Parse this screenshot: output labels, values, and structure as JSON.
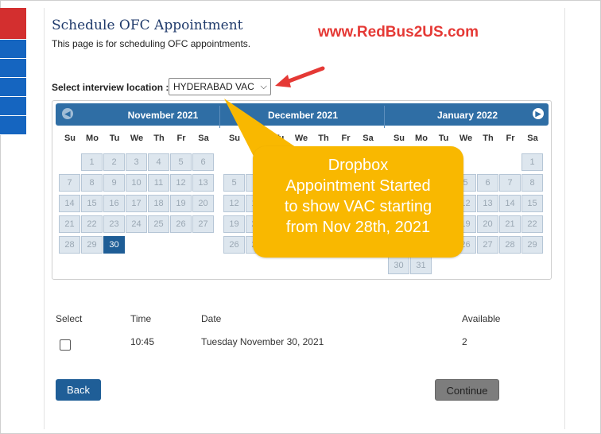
{
  "page": {
    "title": "Schedule OFC Appointment",
    "subtitle": "This page is for scheduling OFC appointments."
  },
  "watermark": "www.RedBus2US.com",
  "location": {
    "label": "Select interview location :",
    "value": "HYDERABAD VAC"
  },
  "calendar": {
    "weekdays": [
      "Su",
      "Mo",
      "Tu",
      "We",
      "Th",
      "Fr",
      "Sa"
    ],
    "months": [
      {
        "name": "November 2021"
      },
      {
        "name": "December 2021"
      },
      {
        "name": "January 2022"
      }
    ],
    "selected_date": "November 30, 2021",
    "nav_prev_icon": "chevron-left-icon",
    "nav_next_icon": "chevron-right-icon"
  },
  "callout": {
    "lines": [
      "Dropbox",
      "Appointment Started",
      "to show VAC starting",
      "from Nov 28th, 2021"
    ],
    "color": "#f9b800"
  },
  "table": {
    "headers": {
      "select": "Select",
      "time": "Time",
      "date": "Date",
      "available": "Available"
    },
    "rows": [
      {
        "time": "10:45",
        "date": "Tuesday November 30, 2021",
        "available": "2"
      }
    ]
  },
  "buttons": {
    "back": "Back",
    "continue": "Continue"
  },
  "colors": {
    "header": "#2f6ea5",
    "selected_day": "#1e5d96",
    "watermark": "#e53935"
  }
}
